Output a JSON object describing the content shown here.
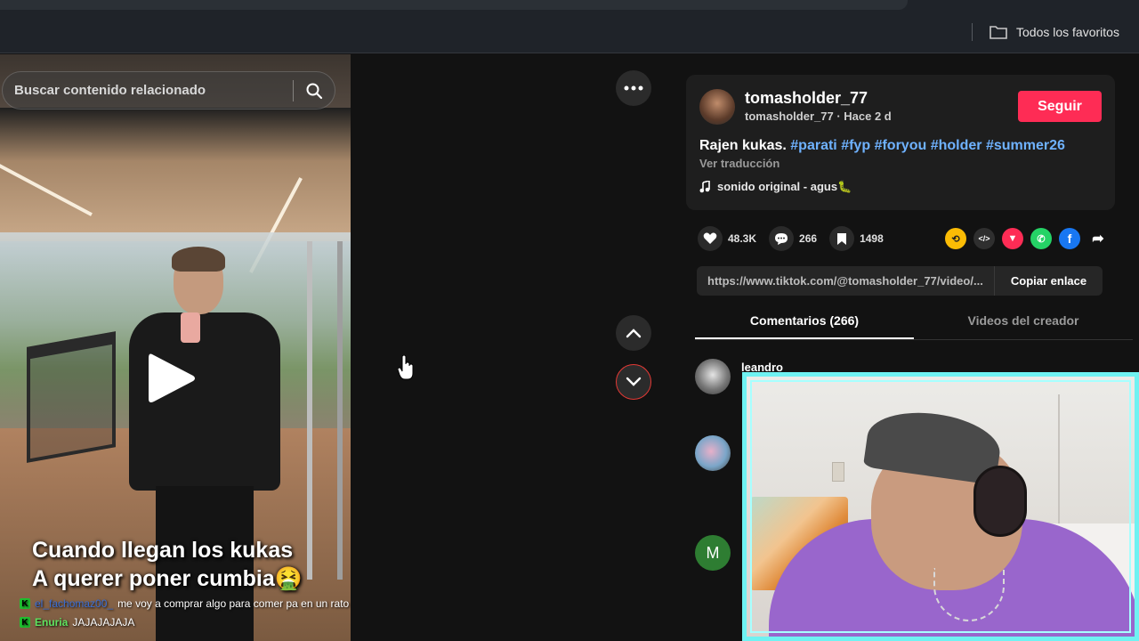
{
  "browser": {
    "bookmarks_label": "Todos los favoritos"
  },
  "video": {
    "search_placeholder": "Buscar contenido relacionado",
    "caption_line1": "Cuando llegan los kukas",
    "caption_line2": "A querer poner cumbia🤮"
  },
  "stream_chat": [
    {
      "user": "el_fachomaz00_",
      "message": "me voy a comprar algo para comer pa en un rato vuelvo"
    },
    {
      "user": "Enuria",
      "message": "JAJAJAJAJA"
    }
  ],
  "post": {
    "username": "tomasholder_77",
    "subtitle": "tomasholder_77 · Hace 2 d",
    "follow_label": "Seguir",
    "description_text": "Rajen kukas.",
    "hashtags": [
      "#parati",
      "#fyp",
      "#foryou",
      "#holder",
      "#summer26"
    ],
    "translate_label": "Ver traducción",
    "sound": "sonido original - agus🐛",
    "likes": "48.3K",
    "comments": "266",
    "saves": "1498",
    "share_icons": [
      "repost-icon",
      "embed-icon",
      "send-icon",
      "whatsapp-icon",
      "facebook-icon",
      "share-arrow-icon"
    ],
    "link": "https://www.tiktok.com/@tomasholder_77/video/...",
    "copy_label": "Copiar enlace"
  },
  "tabs": [
    "Comentarios (266)",
    "Videos del creador"
  ],
  "comments": [
    {
      "name": "leandro",
      "avatar": "photo"
    },
    {
      "name": "",
      "avatar": "photo"
    },
    {
      "name": "",
      "avatar": "M"
    }
  ],
  "colors": {
    "follow_button": "#fe2c55",
    "hashtag": "#6fb2ff",
    "webcam_border": "#6ff2f2",
    "nav_down_ring": "#e53935"
  }
}
